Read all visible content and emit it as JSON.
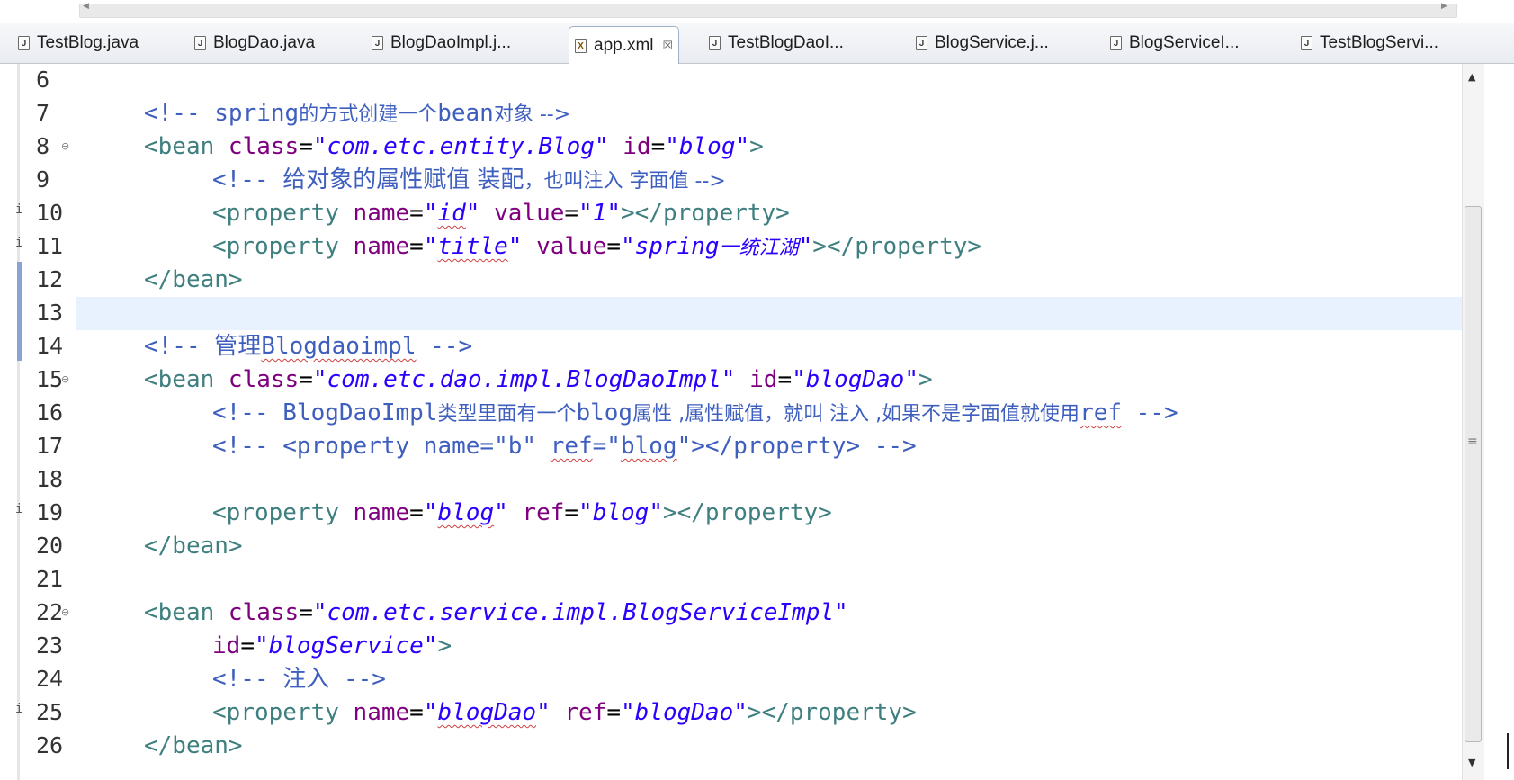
{
  "tabs": [
    {
      "label": "TestBlog.java",
      "icon": "java-file-icon"
    },
    {
      "label": "BlogDao.java",
      "icon": "java-file-icon"
    },
    {
      "label": "BlogDaoImpl.j...",
      "icon": "java-file-icon"
    },
    {
      "label": "app.xml",
      "icon": "xml-file-icon",
      "active": true
    },
    {
      "label": "TestBlogDaoI...",
      "icon": "java-test-file-icon"
    },
    {
      "label": "BlogService.j...",
      "icon": "java-file-icon"
    },
    {
      "label": "BlogServiceI...",
      "icon": "java-file-icon"
    },
    {
      "label": "TestBlogServi...",
      "icon": "java-test-file-icon"
    }
  ],
  "close_glyph": "☒",
  "lines": [
    {
      "n": "6"
    },
    {
      "n": "7",
      "c": "<!-- ",
      "cjk1": "spring",
      "t1": "的方式创建一个",
      "t2": "bean",
      "t3": "对象 -->"
    },
    {
      "n": "8",
      "fold": true
    },
    {
      "n": "9",
      "comment": "<!-- 给对象的属性赋值 装配，也叫注入 字面值 -->"
    },
    {
      "n": "10",
      "marker": "i"
    },
    {
      "n": "11",
      "marker": "i"
    },
    {
      "n": "12"
    },
    {
      "n": "13",
      "current": true
    },
    {
      "n": "14",
      "comment_a": "<!-- 管理",
      "comment_b": "Blogdaoimpl",
      "comment_c": " -->"
    },
    {
      "n": "15",
      "fold": true
    },
    {
      "n": "16",
      "comment_a": "<!-- BlogDaoImpl",
      "comment_b": "类型里面有一个",
      "comment_c": "blog",
      "comment_d": "属性 ,属性赋值，就叫 注入 ,如果不是字面值就使用",
      "comment_e": "ref",
      "comment_f": " -->"
    },
    {
      "n": "17",
      "comment_a": "<!-- <property name=\"b\" ",
      "comment_b": "ref",
      "comment_c": "=\"",
      "comment_d": "blog",
      "comment_e": "\"></property> -->"
    },
    {
      "n": "18"
    },
    {
      "n": "19",
      "marker": "i"
    },
    {
      "n": "20"
    },
    {
      "n": "21"
    },
    {
      "n": "22",
      "fold": true
    },
    {
      "n": "23"
    },
    {
      "n": "24",
      "comment": "<!-- 注入 -->"
    },
    {
      "n": "25",
      "marker": "i"
    },
    {
      "n": "26"
    }
  ],
  "code": {
    "l7_a": "<!-- ",
    "l7_b": "spring",
    "l7_c": "的方式创建一个",
    "l7_d": "bean",
    "l7_e": "对象 -->",
    "l8_tag1": "<bean ",
    "l8_attr1": "class",
    "l8_eq1": "=",
    "l8_val1": "\"com.etc.entity.Blog\"",
    "l8_attr2": " id",
    "l8_eq2": "=",
    "l8_val2": "\"blog\"",
    "l8_tag2": ">",
    "l9_a": "<!-- ",
    "l9_b": "给对象的属性赋值 装配",
    "l9_c": "，也叫注入 字面值 -->",
    "l10_tag1": "<property ",
    "l10_attr1": "name",
    "l10_val1a": "\"",
    "l10_val1b": "id",
    "l10_val1c": "\"",
    "l10_attr2": " value",
    "l10_val2": "\"1\"",
    "l10_tag2": "></property>",
    "l11_tag1": "<property ",
    "l11_attr1": "name",
    "l11_val1a": "\"",
    "l11_val1b": "title",
    "l11_val1c": "\"",
    "l11_attr2": " value",
    "l11_val2a": "\"spring",
    "l11_val2b": "一统江湖",
    "l11_val2c": "\"",
    "l11_tag2": "></property>",
    "l12": "</bean>",
    "l14_a": "<!-- ",
    "l14_b": "管理",
    "l14_c": "Blogdaoimpl",
    "l14_d": " -->",
    "l15_tag1": "<bean ",
    "l15_attr1": "class",
    "l15_val1": "\"com.etc.dao.impl.BlogDaoImpl\"",
    "l15_attr2": " id",
    "l15_val2": "\"blogDao\"",
    "l15_tag2": ">",
    "l16_a": "<!-- BlogDaoImpl",
    "l16_b": "类型里面有一个",
    "l16_c": "blog",
    "l16_d": "属性 ,属性赋值，就叫 注入 ,如果不是字面值就使用",
    "l16_e": "ref",
    "l16_f": " -->",
    "l17_a": "<!-- <property name=\"b\" ",
    "l17_b": "ref",
    "l17_c": "=\"",
    "l17_d": "blog",
    "l17_e": "\"></property> -->",
    "l19_tag1": "<property ",
    "l19_attr1": "name",
    "l19_val1a": "\"",
    "l19_val1b": "blog",
    "l19_val1c": "\"",
    "l19_attr2": " ref",
    "l19_val2": "\"blog\"",
    "l19_tag2": "></property>",
    "l20": "</bean>",
    "l22_tag1": "<bean ",
    "l22_attr1": "class",
    "l22_val1": "\"com.etc.service.impl.BlogServiceImpl\"",
    "l23_attr": "id",
    "l23_val": "\"blogService\"",
    "l23_tag": ">",
    "l24_a": "<!-- ",
    "l24_b": "注入",
    "l24_c": " -->",
    "l25_tag1": "<property ",
    "l25_attr1": "name",
    "l25_val1a": "\"",
    "l25_val1b": "blogDao",
    "l25_val1c": "\"",
    "l25_attr2": " ref",
    "l25_val2": "\"blogDao\"",
    "l25_tag2": "></property>",
    "l26": "</bean>",
    "eq": "="
  },
  "colors": {
    "comment": "#3f5fbf",
    "tag": "#3f7f7f",
    "attribute": "#7f007f",
    "string": "#2a00ff",
    "current_line": "#e8f2fe"
  }
}
